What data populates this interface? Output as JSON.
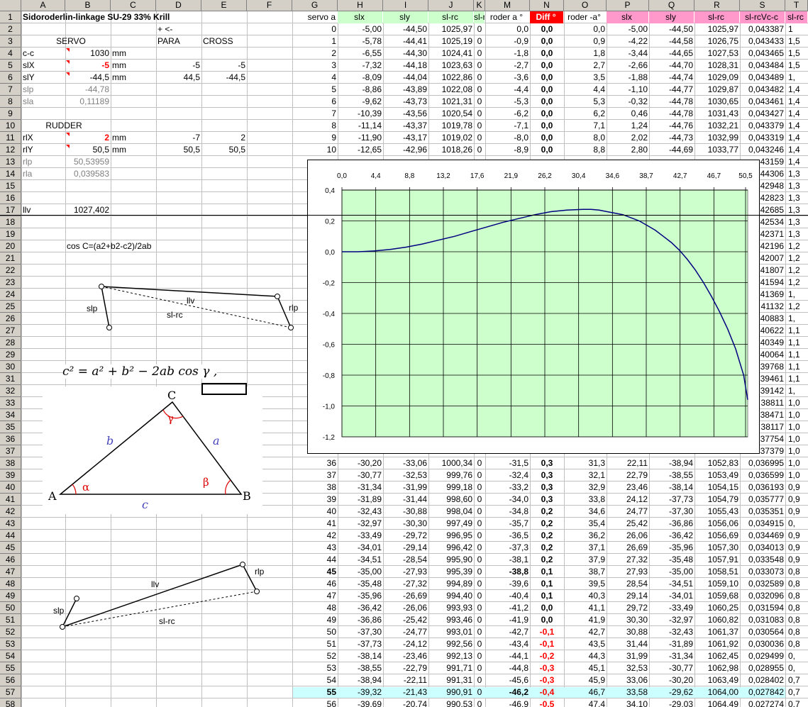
{
  "columns": [
    "A",
    "B",
    "C",
    "D",
    "E",
    "F",
    "G",
    "H",
    "I",
    "J",
    "K",
    "M",
    "N",
    "O",
    "P",
    "Q",
    "R",
    "S",
    "T"
  ],
  "title": "Sidoroderlin-linkage SU-29 33% Krill",
  "header_row": {
    "G": "servo a",
    "H": "slx",
    "I": "sly",
    "J": "sl-rc",
    "K": "sl-r",
    "M": "roder a °",
    "N": "Diff °",
    "O": "roder -a°",
    "P": "slx",
    "Q": "sly",
    "R": "sl-rc",
    "S": "sl-rcVc-c",
    "T": "sl-rc"
  },
  "left": {
    "d2": "+ <-",
    "servo_label": "SERVO",
    "para_label": "PARA",
    "cross_label": "CROSS",
    "cc_label": "c-c",
    "cc_value": "1030",
    "cc_unit": "mm",
    "slx_label": "slX",
    "slx_value": "-5",
    "slx_unit": "mm",
    "slx_para": "-5",
    "slx_cross": "-5",
    "sly_label": "slY",
    "sly_value": "-44,5",
    "sly_unit": "mm",
    "sly_para": "44,5",
    "sly_cross": "-44,5",
    "slp_label": "slp",
    "slp_value": "-44,78",
    "sla_label": "sla",
    "sla_value": "0,11189",
    "rudder_label": "RUDDER",
    "rlx_label": "rlX",
    "rlx_value": "2",
    "rlx_unit": "mm",
    "rlx_para": "-7",
    "rlx_cross": "2",
    "rly_label": "rlY",
    "rly_value": "50,5",
    "rly_unit": "mm",
    "rly_para": "50,5",
    "rly_cross": "50,5",
    "rlp_label": "rlp",
    "rlp_value": "50,53959",
    "rla_label": "rla",
    "rla_value": "0,039583",
    "llv_label": "llv",
    "llv_value": "1027,402",
    "cos_formula": "cos C=(a2+b2-c2)/2ab"
  },
  "diagram1": {
    "llv": "llv",
    "slp": "slp",
    "slrc": "sl-rc",
    "rlp": "rlp"
  },
  "diagram2": {
    "llv": "llv",
    "slp": "slp",
    "slrc": "sl-rc",
    "rlp": "rlp"
  },
  "law_of_cosines": "c² = a² + b² − 2ab cos γ ,",
  "triangle": {
    "A": "A",
    "B": "B",
    "C": "C",
    "a": "a",
    "b": "b",
    "c": "c",
    "alpha": "α",
    "beta": "β",
    "gamma": "γ"
  },
  "rows_top": [
    [
      "0",
      "-5,00",
      "-44,50",
      "1025,97",
      "0",
      "0,0",
      "0,0",
      "0,0",
      "-5,00",
      "-44,50",
      "1025,97",
      "0,043387",
      "1"
    ],
    [
      "1",
      "-5,78",
      "-44,41",
      "1025,19",
      "0",
      "-0,9",
      "0,0",
      "0,9",
      "-4,22",
      "-44,58",
      "1026,75",
      "0,043433",
      "1,5"
    ],
    [
      "2",
      "-6,55",
      "-44,30",
      "1024,41",
      "0",
      "-1,8",
      "0,0",
      "1,8",
      "-3,44",
      "-44,65",
      "1027,53",
      "0,043465",
      "1,5"
    ],
    [
      "3",
      "-7,32",
      "-44,18",
      "1023,63",
      "0",
      "-2,7",
      "0,0",
      "2,7",
      "-2,66",
      "-44,70",
      "1028,31",
      "0,043484",
      "1,5"
    ],
    [
      "4",
      "-8,09",
      "-44,04",
      "1022,86",
      "0",
      "-3,6",
      "0,0",
      "3,5",
      "-1,88",
      "-44,74",
      "1029,09",
      "0,043489",
      "1,"
    ],
    [
      "5",
      "-8,86",
      "-43,89",
      "1022,08",
      "0",
      "-4,4",
      "0,0",
      "4,4",
      "-1,10",
      "-44,77",
      "1029,87",
      "0,043482",
      "1,4"
    ],
    [
      "6",
      "-9,62",
      "-43,73",
      "1021,31",
      "0",
      "-5,3",
      "0,0",
      "5,3",
      "-0,32",
      "-44,78",
      "1030,65",
      "0,043461",
      "1,4"
    ],
    [
      "7",
      "-10,39",
      "-43,56",
      "1020,54",
      "0",
      "-6,2",
      "0,0",
      "6,2",
      "0,46",
      "-44,78",
      "1031,43",
      "0,043427",
      "1,4"
    ],
    [
      "8",
      "-11,14",
      "-43,37",
      "1019,78",
      "0",
      "-7,1",
      "0,0",
      "7,1",
      "1,24",
      "-44,76",
      "1032,21",
      "0,043379",
      "1,4"
    ],
    [
      "9",
      "-11,90",
      "-43,17",
      "1019,02",
      "0",
      "-8,0",
      "0,0",
      "8,0",
      "2,02",
      "-44,73",
      "1032,99",
      "0,043319",
      "1,4"
    ],
    [
      "10",
      "-12,65",
      "-42,96",
      "1018,26",
      "0",
      "-8,9",
      "0,0",
      "8,8",
      "2,80",
      "-44,69",
      "1033,77",
      "0,043246",
      "1,4"
    ]
  ],
  "s_partial": [
    "43159",
    "44306",
    "42948",
    "42823",
    "42685",
    "42534",
    "42371",
    "42196",
    "42007",
    "41807",
    "41594",
    "41369",
    "41132",
    "40883",
    "40622",
    "40349",
    "40064",
    "39768",
    "39461",
    "39142",
    "38811",
    "38471",
    "38117",
    "37754",
    "37379"
  ],
  "t_partial": [
    "1,4",
    "1,3",
    "1,3",
    "1,3",
    "1,3",
    "1,3",
    "1,3",
    "1,2",
    "1,2",
    "1,2",
    "1,2",
    "1,",
    "1,2",
    "1,",
    "1,1",
    "1,1",
    "1,1",
    "1,1",
    "1,1",
    "1,",
    "1,0",
    "1,0",
    "1,0",
    "1,0",
    "1,0"
  ],
  "rows_bottom": [
    [
      "36",
      "-30,20",
      "-33,06",
      "1000,34",
      "0",
      "-31,5",
      "0,3",
      "31,3",
      "22,11",
      "-38,94",
      "1052,83",
      "0,036995",
      "1,0"
    ],
    [
      "37",
      "-30,77",
      "-32,53",
      "999,76",
      "0",
      "-32,4",
      "0,3",
      "32,1",
      "22,79",
      "-38,55",
      "1053,49",
      "0,036599",
      "1,0"
    ],
    [
      "38",
      "-31,34",
      "-31,99",
      "999,18",
      "0",
      "-33,2",
      "0,3",
      "32,9",
      "23,46",
      "-38,14",
      "1054,15",
      "0,036193",
      "0,9"
    ],
    [
      "39",
      "-31,89",
      "-31,44",
      "998,60",
      "0",
      "-34,0",
      "0,3",
      "33,8",
      "24,12",
      "-37,73",
      "1054,79",
      "0,035777",
      "0,9"
    ],
    [
      "40",
      "-32,43",
      "-30,88",
      "998,04",
      "0",
      "-34,8",
      "0,2",
      "34,6",
      "24,77",
      "-37,30",
      "1055,43",
      "0,035351",
      "0,9"
    ],
    [
      "41",
      "-32,97",
      "-30,30",
      "997,49",
      "0",
      "-35,7",
      "0,2",
      "35,4",
      "25,42",
      "-36,86",
      "1056,06",
      "0,034915",
      "0,"
    ],
    [
      "42",
      "-33,49",
      "-29,72",
      "996,95",
      "0",
      "-36,5",
      "0,2",
      "36,2",
      "26,06",
      "-36,42",
      "1056,69",
      "0,034469",
      "0,9"
    ],
    [
      "43",
      "-34,01",
      "-29,14",
      "996,42",
      "0",
      "-37,3",
      "0,2",
      "37,1",
      "26,69",
      "-35,96",
      "1057,30",
      "0,034013",
      "0,9"
    ],
    [
      "44",
      "-34,51",
      "-28,54",
      "995,90",
      "0",
      "-38,1",
      "0,2",
      "37,9",
      "27,32",
      "-35,48",
      "1057,91",
      "0,033548",
      "0,9"
    ],
    [
      "45",
      "-35,00",
      "-27,93",
      "995,39",
      "0",
      "-38,8",
      "0,1",
      "38,7",
      "27,93",
      "-35,00",
      "1058,51",
      "0,033073",
      "0,8"
    ],
    [
      "46",
      "-35,48",
      "-27,32",
      "994,89",
      "0",
      "-39,6",
      "0,1",
      "39,5",
      "28,54",
      "-34,51",
      "1059,10",
      "0,032589",
      "0,8"
    ],
    [
      "47",
      "-35,96",
      "-26,69",
      "994,40",
      "0",
      "-40,4",
      "0,1",
      "40,3",
      "29,14",
      "-34,01",
      "1059,68",
      "0,032096",
      "0,8"
    ],
    [
      "48",
      "-36,42",
      "-26,06",
      "993,93",
      "0",
      "-41,2",
      "0,0",
      "41,1",
      "29,72",
      "-33,49",
      "1060,25",
      "0,031594",
      "0,8"
    ],
    [
      "49",
      "-36,86",
      "-25,42",
      "993,46",
      "0",
      "-41,9",
      "0,0",
      "41,9",
      "30,30",
      "-32,97",
      "1060,82",
      "0,031083",
      "0,8"
    ],
    [
      "50",
      "-37,30",
      "-24,77",
      "993,01",
      "0",
      "-42,7",
      "-0,1",
      "42,7",
      "30,88",
      "-32,43",
      "1061,37",
      "0,030564",
      "0,8"
    ],
    [
      "51",
      "-37,73",
      "-24,12",
      "992,56",
      "0",
      "-43,4",
      "-0,1",
      "43,5",
      "31,44",
      "-31,89",
      "1061,92",
      "0,030036",
      "0,8"
    ],
    [
      "52",
      "-38,14",
      "-23,46",
      "992,13",
      "0",
      "-44,1",
      "-0,2",
      "44,3",
      "31,99",
      "-31,34",
      "1062,45",
      "0,029499",
      "0,"
    ],
    [
      "53",
      "-38,55",
      "-22,79",
      "991,71",
      "0",
      "-44,8",
      "-0,3",
      "45,1",
      "32,53",
      "-30,77",
      "1062,98",
      "0,028955",
      "0,"
    ],
    [
      "54",
      "-38,94",
      "-22,11",
      "991,31",
      "0",
      "-45,6",
      "-0,3",
      "45,9",
      "33,06",
      "-30,20",
      "1063,49",
      "0,028402",
      "0,7"
    ],
    [
      "55",
      "-39,32",
      "-21,43",
      "990,91",
      "0",
      "-46,2",
      "-0,4",
      "46,7",
      "33,58",
      "-29,62",
      "1064,00",
      "0,027842",
      "0,7"
    ],
    [
      "56",
      "-39,69",
      "-20,74",
      "990,53",
      "0",
      "-46,9",
      "-0,5",
      "47,4",
      "34,10",
      "-29,03",
      "1064,49",
      "0,027274",
      "0,7"
    ]
  ],
  "chart_data": {
    "type": "line",
    "x_tick_labels": [
      "0,0",
      "4,4",
      "8,8",
      "13,2",
      "17,6",
      "21,9",
      "26,2",
      "30,4",
      "34,6",
      "38,7",
      "42,7",
      "46,7",
      "50,5"
    ],
    "y_tick_labels": [
      "0,4",
      "0,2",
      "0,0",
      "-0,2",
      "-0,4",
      "-0,6",
      "-0,8",
      "-1,0",
      "-1,2"
    ],
    "ylim": [
      -1.2,
      0.4
    ],
    "xlim": [
      0,
      50.5
    ],
    "plot_bg": "#ccffcc",
    "line_color": "#000080",
    "grid": true,
    "series": [
      {
        "x": [
          0,
          2,
          4,
          6,
          8,
          10,
          12,
          14,
          16,
          18,
          20,
          22,
          24,
          26,
          28,
          30,
          31,
          32,
          33,
          34,
          35,
          36,
          37,
          38,
          39,
          40,
          41,
          42,
          43,
          44,
          45,
          46,
          47,
          48,
          49,
          50,
          50.5
        ],
        "y": [
          0,
          0,
          0.005,
          0.015,
          0.03,
          0.05,
          0.075,
          0.1,
          0.13,
          0.16,
          0.19,
          0.215,
          0.24,
          0.26,
          0.27,
          0.275,
          0.275,
          0.27,
          0.26,
          0.25,
          0.24,
          0.22,
          0.2,
          0.17,
          0.14,
          0.1,
          0.06,
          0.01,
          -0.05,
          -0.12,
          -0.2,
          -0.29,
          -0.39,
          -0.5,
          -0.63,
          -0.8,
          -0.96
        ]
      }
    ]
  }
}
